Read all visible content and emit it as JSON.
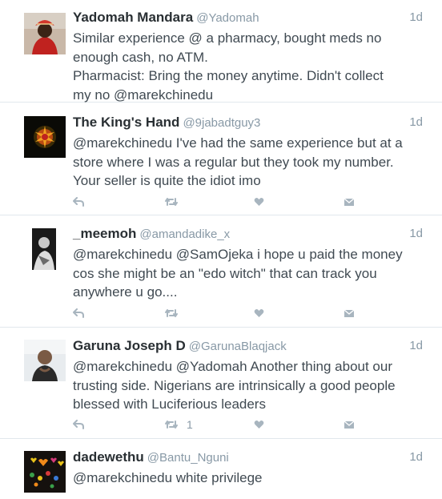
{
  "tweets": [
    {
      "name": "Yadomah Mandara",
      "handle": "@Yadomah",
      "time": "1d",
      "lines": [
        "Similar experience @ a pharmacy, bought meds no",
        "enough cash, no ATM.",
        "Pharmacist: Bring the money anytime. Didn't collect",
        "my no @marekchinedu"
      ],
      "retweet_count": ""
    },
    {
      "name": "The King's Hand",
      "handle": "@9jabadtguy3",
      "time": "1d",
      "lines": [
        "@marekchinedu I've had the same experience but at a",
        "store where I was a regular but they took my number.",
        "Your seller is quite the idiot imo"
      ],
      "retweet_count": ""
    },
    {
      "name": "_meemoh",
      "handle": "@amandadike_x",
      "time": "1d",
      "lines": [
        "@marekchinedu @SamOjeka i hope u paid the money",
        "cos she might be an \"edo witch\" that can track you",
        "anywhere u go...."
      ],
      "retweet_count": ""
    },
    {
      "name": "Garuna Joseph D",
      "handle": "@GarunaBlaqjack",
      "time": "1d",
      "lines": [
        "@marekchinedu @Yadomah Another thing about our",
        "trusting side. Nigerians are intrinsically a good people",
        "blessed with Luciferious leaders"
      ],
      "retweet_count": "1"
    },
    {
      "name": "dadewethu",
      "handle": "@Bantu_Nguni",
      "time": "1d",
      "lines": [
        "@marekchinedu white privilege"
      ],
      "retweet_count": ""
    }
  ],
  "icons": {
    "reply": "reply-icon",
    "retweet": "retweet-icon",
    "like": "heart-icon",
    "message": "direct-message-icon"
  },
  "colors": {
    "icon": "#a8b5bf",
    "secondary_text": "#8899a6",
    "divider": "#e1e8ed"
  }
}
